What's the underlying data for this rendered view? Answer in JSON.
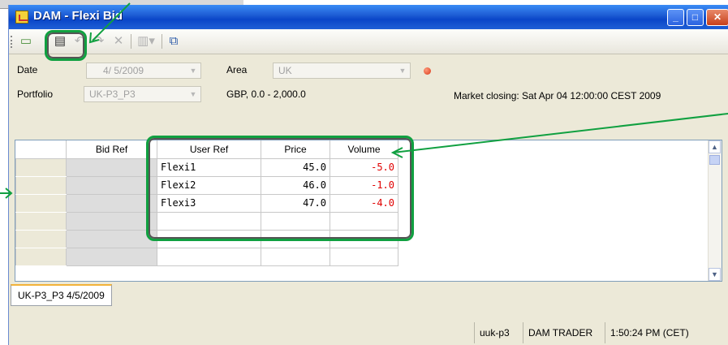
{
  "window": {
    "title": "DAM - Flexi Bid",
    "controls": [
      "minimize-icon",
      "maximize-icon",
      "close-icon"
    ]
  },
  "toolbar": {
    "icons": [
      "new-icon",
      "save-icon",
      "undo-icon",
      "redo-icon",
      "delete-icon",
      "columns-icon",
      "help-icon"
    ]
  },
  "form": {
    "date_label": "Date",
    "date_value": "4/ 5/2009",
    "area_label": "Area",
    "area_value": "UK",
    "portfolio_label": "Portfolio",
    "portfolio_value": "UK-P3_P3",
    "range_text": "GBP, 0.0 - 2,000.0",
    "market_closing": "Market closing: Sat Apr 04 12:00:00 CEST 2009"
  },
  "grid": {
    "columns": [
      "Bid Ref",
      "User Ref",
      "Price",
      "Volume"
    ],
    "rows": [
      {
        "bid_ref": "",
        "user_ref": "Flexi1",
        "price": "45.0",
        "volume": "-5.0"
      },
      {
        "bid_ref": "",
        "user_ref": "Flexi2",
        "price": "46.0",
        "volume": "-1.0"
      },
      {
        "bid_ref": "",
        "user_ref": "Flexi3",
        "price": "47.0",
        "volume": "-4.0"
      },
      {
        "bid_ref": "",
        "user_ref": "",
        "price": "",
        "volume": ""
      },
      {
        "bid_ref": "",
        "user_ref": "",
        "price": "",
        "volume": ""
      },
      {
        "bid_ref": "",
        "user_ref": "",
        "price": "",
        "volume": ""
      }
    ]
  },
  "tabs": [
    {
      "label": "UK-P3_P3 4/5/2009",
      "active": true
    }
  ],
  "status": {
    "user": "uuk-p3",
    "role": "DAM TRADER",
    "time": "1:50:24 PM (CET)"
  },
  "colors": {
    "annotation": "#10a040",
    "negative_volume": "#e00000",
    "title_bar": "#0a46c8"
  }
}
